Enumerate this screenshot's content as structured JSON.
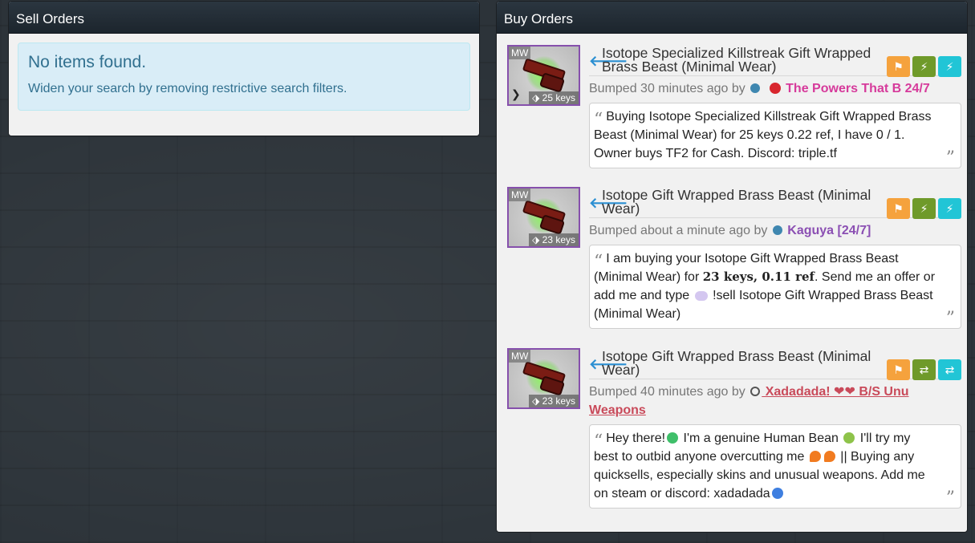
{
  "sell": {
    "header": "Sell Orders",
    "empty_title": "No items found.",
    "empty_text": "Widen your search by removing restrictive search filters."
  },
  "buy": {
    "header": "Buy Orders",
    "listings": [
      {
        "quality": "MW",
        "price": "25 keys",
        "title": "Isotope Specialized Killstreak Gift Wrapped Brass Beast (Minimal Wear)",
        "bumped": "Bumped 30 minutes ago by",
        "user": "The Powers That B 24/7",
        "user_color": "#d63a9b",
        "message": "Buying Isotope Specialized Killstreak Gift Wrapped Brass Beast (Minimal Wear) for 25 keys 0.22 ref, I have 0 / 1. Owner buys TF2 for Cash. Discord: triple.tf"
      },
      {
        "quality": "MW",
        "price": "23 keys",
        "title": "Isotope Gift Wrapped Brass Beast (Minimal Wear)",
        "bumped": "Bumped about a minute ago by",
        "user": "Kaguya [24/7]",
        "user_color": "#8b4fb3",
        "message_a": "I am buying your Isotope Gift Wrapped Brass Beast (Minimal Wear) for ",
        "message_b": "23 keys, 0.11 ref",
        "message_c": ". Send me an offer or add me and type ",
        "message_d": " !sell Isotope Gift Wrapped Brass Beast (Minimal Wear)"
      },
      {
        "quality": "MW",
        "price": "23 keys",
        "title": "Isotope Gift Wrapped Brass Beast (Minimal Wear)",
        "bumped": "Bumped 40 minutes ago by",
        "user": " Xadadada! ❤❤ B/S Unu Weapons",
        "user_color": "#c94a5a",
        "message_a": "Hey there!",
        "message_b": " I'm a genuine Human Bean ",
        "message_c": " I'll try my best to outbid anyone overcutting me ",
        "message_d": " || Buying any quicksells, especially skins and unusual weapons. Add me on steam or discord: xadadada"
      }
    ]
  },
  "icons": [
    "flag-icon",
    "bolt-icon",
    "exchange-icon",
    "arrow-left-icon",
    "tag-icon",
    "quote-icon"
  ]
}
